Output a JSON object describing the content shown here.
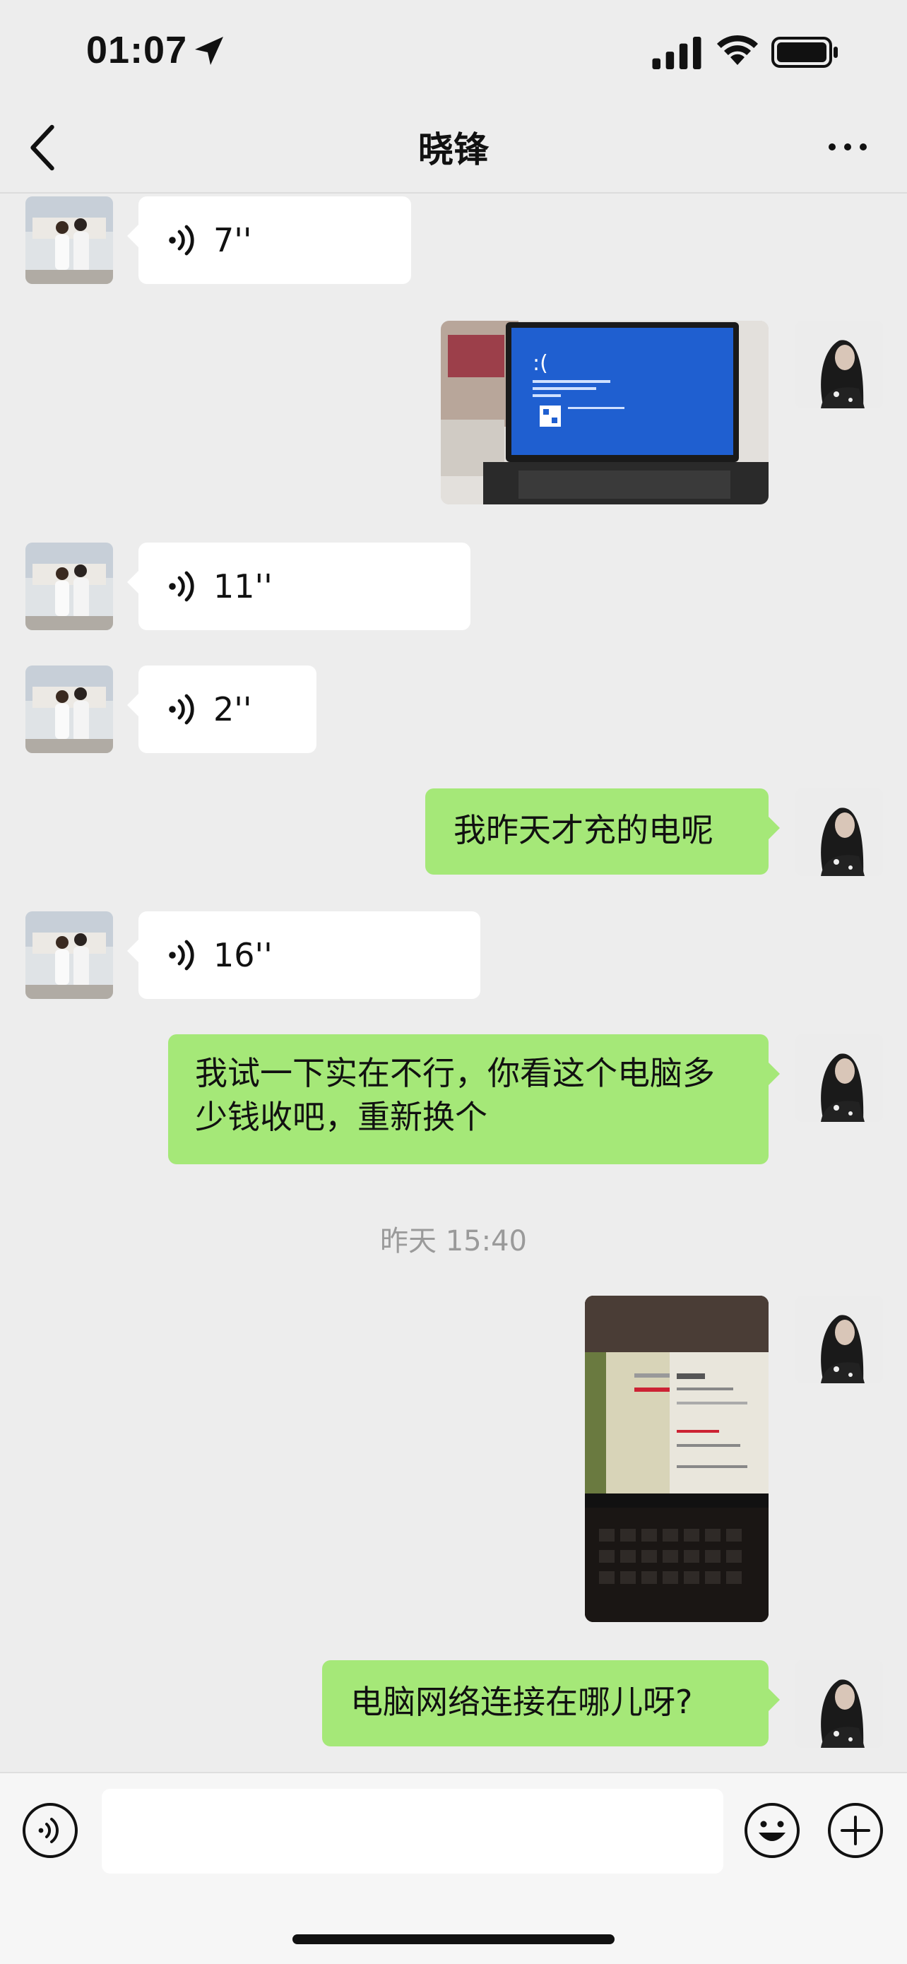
{
  "status_bar": {
    "time": "01:07"
  },
  "header": {
    "title": "晓锋"
  },
  "messages": [
    {
      "side": "left",
      "type": "voice",
      "duration": "7''"
    },
    {
      "side": "right",
      "type": "image",
      "description_icon": "laptop-blue-screen-photo"
    },
    {
      "side": "left",
      "type": "voice",
      "duration": "11''"
    },
    {
      "side": "left",
      "type": "voice",
      "duration": "2''"
    },
    {
      "side": "right",
      "type": "text",
      "text": "我昨天才充的电呢"
    },
    {
      "side": "left",
      "type": "voice",
      "duration": "16''"
    },
    {
      "side": "right",
      "type": "text",
      "text": "我试一下实在不行，你看这个电脑多少钱收吧，重新换个"
    },
    {
      "type": "timestamp",
      "text": "昨天 15:40"
    },
    {
      "side": "right",
      "type": "image",
      "description_icon": "laptop-network-settings-photo"
    },
    {
      "side": "right",
      "type": "text",
      "text": "电脑网络连接在哪儿呀?"
    }
  ],
  "input_bar": {
    "value": ""
  },
  "colors": {
    "background": "#ededed",
    "own_bubble": "#a5e878",
    "other_bubble": "#ffffff",
    "timestamp": "#9a9a9a"
  }
}
